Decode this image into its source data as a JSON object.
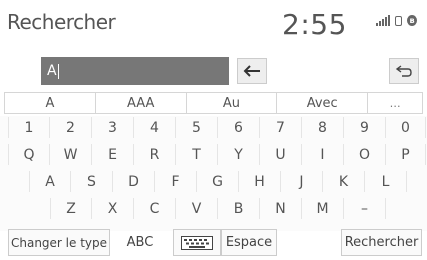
{
  "header": {
    "title": "Rechercher",
    "clock": "2:55"
  },
  "input": {
    "value": "A"
  },
  "suggestions": [
    "A",
    "AAA",
    "Au",
    "Avec",
    "…"
  ],
  "keyboard": {
    "digits": [
      "1",
      "2",
      "3",
      "4",
      "5",
      "6",
      "7",
      "8",
      "9",
      "0"
    ],
    "row1": [
      "Q",
      "W",
      "E",
      "R",
      "T",
      "Y",
      "U",
      "I",
      "O",
      "P"
    ],
    "row2": [
      "A",
      "S",
      "D",
      "F",
      "G",
      "H",
      "J",
      "K",
      "L"
    ],
    "row3": [
      "Z",
      "X",
      "C",
      "V",
      "B",
      "N",
      "M",
      "–"
    ]
  },
  "bottom": {
    "change_type": "Changer le type",
    "abc": "ABC",
    "space": "Espace",
    "search": "Rechercher"
  },
  "icons": {
    "backspace": "arrow-left-icon",
    "return": "return-arrow-icon",
    "keyboard": "keyboard-icon",
    "signal": "signal-bars-icon",
    "phone": "phone-battery-icon",
    "bluetooth": "bluetooth-icon"
  }
}
